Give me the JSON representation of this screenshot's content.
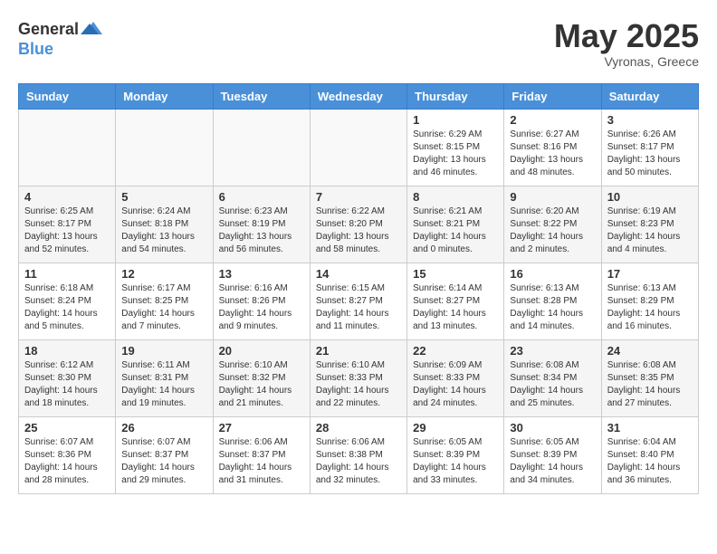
{
  "header": {
    "logo_general": "General",
    "logo_blue": "Blue",
    "month_year": "May 2025",
    "location": "Vyronas, Greece"
  },
  "days_of_week": [
    "Sunday",
    "Monday",
    "Tuesday",
    "Wednesday",
    "Thursday",
    "Friday",
    "Saturday"
  ],
  "weeks": [
    [
      {
        "day": "",
        "sunrise": "",
        "sunset": "",
        "daylight": ""
      },
      {
        "day": "",
        "sunrise": "",
        "sunset": "",
        "daylight": ""
      },
      {
        "day": "",
        "sunrise": "",
        "sunset": "",
        "daylight": ""
      },
      {
        "day": "",
        "sunrise": "",
        "sunset": "",
        "daylight": ""
      },
      {
        "day": "1",
        "sunrise": "6:29 AM",
        "sunset": "8:15 PM",
        "daylight": "13 hours and 46 minutes."
      },
      {
        "day": "2",
        "sunrise": "6:27 AM",
        "sunset": "8:16 PM",
        "daylight": "13 hours and 48 minutes."
      },
      {
        "day": "3",
        "sunrise": "6:26 AM",
        "sunset": "8:17 PM",
        "daylight": "13 hours and 50 minutes."
      }
    ],
    [
      {
        "day": "4",
        "sunrise": "6:25 AM",
        "sunset": "8:17 PM",
        "daylight": "13 hours and 52 minutes."
      },
      {
        "day": "5",
        "sunrise": "6:24 AM",
        "sunset": "8:18 PM",
        "daylight": "13 hours and 54 minutes."
      },
      {
        "day": "6",
        "sunrise": "6:23 AM",
        "sunset": "8:19 PM",
        "daylight": "13 hours and 56 minutes."
      },
      {
        "day": "7",
        "sunrise": "6:22 AM",
        "sunset": "8:20 PM",
        "daylight": "13 hours and 58 minutes."
      },
      {
        "day": "8",
        "sunrise": "6:21 AM",
        "sunset": "8:21 PM",
        "daylight": "14 hours and 0 minutes."
      },
      {
        "day": "9",
        "sunrise": "6:20 AM",
        "sunset": "8:22 PM",
        "daylight": "14 hours and 2 minutes."
      },
      {
        "day": "10",
        "sunrise": "6:19 AM",
        "sunset": "8:23 PM",
        "daylight": "14 hours and 4 minutes."
      }
    ],
    [
      {
        "day": "11",
        "sunrise": "6:18 AM",
        "sunset": "8:24 PM",
        "daylight": "14 hours and 5 minutes."
      },
      {
        "day": "12",
        "sunrise": "6:17 AM",
        "sunset": "8:25 PM",
        "daylight": "14 hours and 7 minutes."
      },
      {
        "day": "13",
        "sunrise": "6:16 AM",
        "sunset": "8:26 PM",
        "daylight": "14 hours and 9 minutes."
      },
      {
        "day": "14",
        "sunrise": "6:15 AM",
        "sunset": "8:27 PM",
        "daylight": "14 hours and 11 minutes."
      },
      {
        "day": "15",
        "sunrise": "6:14 AM",
        "sunset": "8:27 PM",
        "daylight": "14 hours and 13 minutes."
      },
      {
        "day": "16",
        "sunrise": "6:13 AM",
        "sunset": "8:28 PM",
        "daylight": "14 hours and 14 minutes."
      },
      {
        "day": "17",
        "sunrise": "6:13 AM",
        "sunset": "8:29 PM",
        "daylight": "14 hours and 16 minutes."
      }
    ],
    [
      {
        "day": "18",
        "sunrise": "6:12 AM",
        "sunset": "8:30 PM",
        "daylight": "14 hours and 18 minutes."
      },
      {
        "day": "19",
        "sunrise": "6:11 AM",
        "sunset": "8:31 PM",
        "daylight": "14 hours and 19 minutes."
      },
      {
        "day": "20",
        "sunrise": "6:10 AM",
        "sunset": "8:32 PM",
        "daylight": "14 hours and 21 minutes."
      },
      {
        "day": "21",
        "sunrise": "6:10 AM",
        "sunset": "8:33 PM",
        "daylight": "14 hours and 22 minutes."
      },
      {
        "day": "22",
        "sunrise": "6:09 AM",
        "sunset": "8:33 PM",
        "daylight": "14 hours and 24 minutes."
      },
      {
        "day": "23",
        "sunrise": "6:08 AM",
        "sunset": "8:34 PM",
        "daylight": "14 hours and 25 minutes."
      },
      {
        "day": "24",
        "sunrise": "6:08 AM",
        "sunset": "8:35 PM",
        "daylight": "14 hours and 27 minutes."
      }
    ],
    [
      {
        "day": "25",
        "sunrise": "6:07 AM",
        "sunset": "8:36 PM",
        "daylight": "14 hours and 28 minutes."
      },
      {
        "day": "26",
        "sunrise": "6:07 AM",
        "sunset": "8:37 PM",
        "daylight": "14 hours and 29 minutes."
      },
      {
        "day": "27",
        "sunrise": "6:06 AM",
        "sunset": "8:37 PM",
        "daylight": "14 hours and 31 minutes."
      },
      {
        "day": "28",
        "sunrise": "6:06 AM",
        "sunset": "8:38 PM",
        "daylight": "14 hours and 32 minutes."
      },
      {
        "day": "29",
        "sunrise": "6:05 AM",
        "sunset": "8:39 PM",
        "daylight": "14 hours and 33 minutes."
      },
      {
        "day": "30",
        "sunrise": "6:05 AM",
        "sunset": "8:39 PM",
        "daylight": "14 hours and 34 minutes."
      },
      {
        "day": "31",
        "sunrise": "6:04 AM",
        "sunset": "8:40 PM",
        "daylight": "14 hours and 36 minutes."
      }
    ]
  ]
}
